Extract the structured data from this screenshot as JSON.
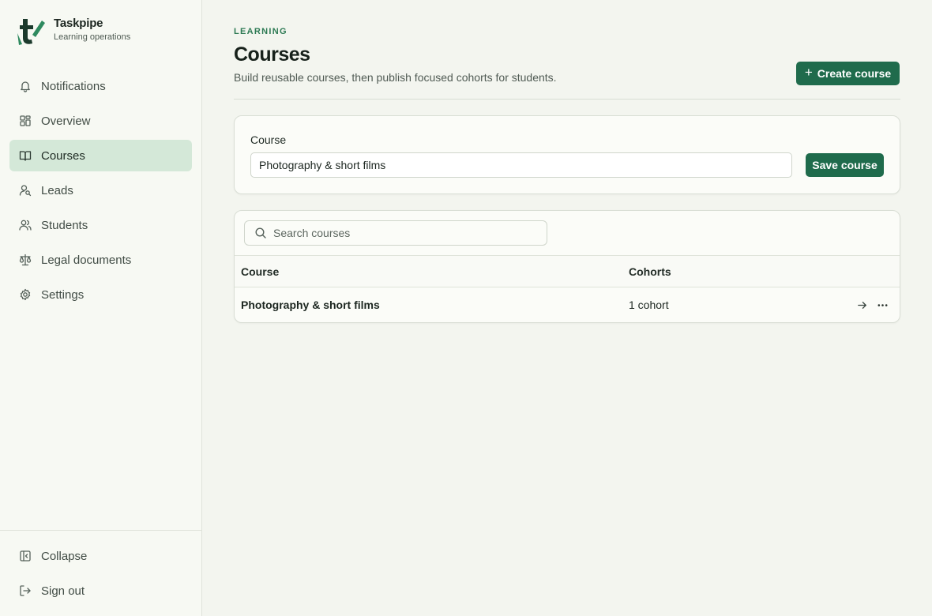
{
  "brand": {
    "name": "Taskpipe",
    "subtitle": "Learning operations"
  },
  "sidebar": {
    "items": [
      {
        "label": "Notifications",
        "icon": "bell-icon",
        "active": false
      },
      {
        "label": "Overview",
        "icon": "grid-icon",
        "active": false
      },
      {
        "label": "Courses",
        "icon": "book-icon",
        "active": true
      },
      {
        "label": "Leads",
        "icon": "user-search-icon",
        "active": false
      },
      {
        "label": "Students",
        "icon": "users-icon",
        "active": false
      },
      {
        "label": "Legal documents",
        "icon": "scale-icon",
        "active": false
      },
      {
        "label": "Settings",
        "icon": "gear-icon",
        "active": false
      }
    ],
    "bottom": [
      {
        "label": "Collapse",
        "icon": "collapse-icon"
      },
      {
        "label": "Sign out",
        "icon": "sign-out-icon"
      }
    ]
  },
  "header": {
    "eyebrow": "LEARNING",
    "title": "Courses",
    "subtitle": "Build reusable courses, then publish focused cohorts for students.",
    "create_label": "Create course"
  },
  "form": {
    "label": "Course",
    "value": "Photography & short films",
    "save_label": "Save course"
  },
  "table": {
    "search_placeholder": "Search courses",
    "columns": [
      "Course",
      "Cohorts"
    ],
    "rows": [
      {
        "course": "Photography & short films",
        "cohorts": "1 cohort"
      }
    ]
  },
  "colors": {
    "accent": "#1f6b4c",
    "active_nav_bg": "#d4e8d8",
    "eyebrow": "#2d7a54",
    "page_bg": "#f3f5ef"
  }
}
